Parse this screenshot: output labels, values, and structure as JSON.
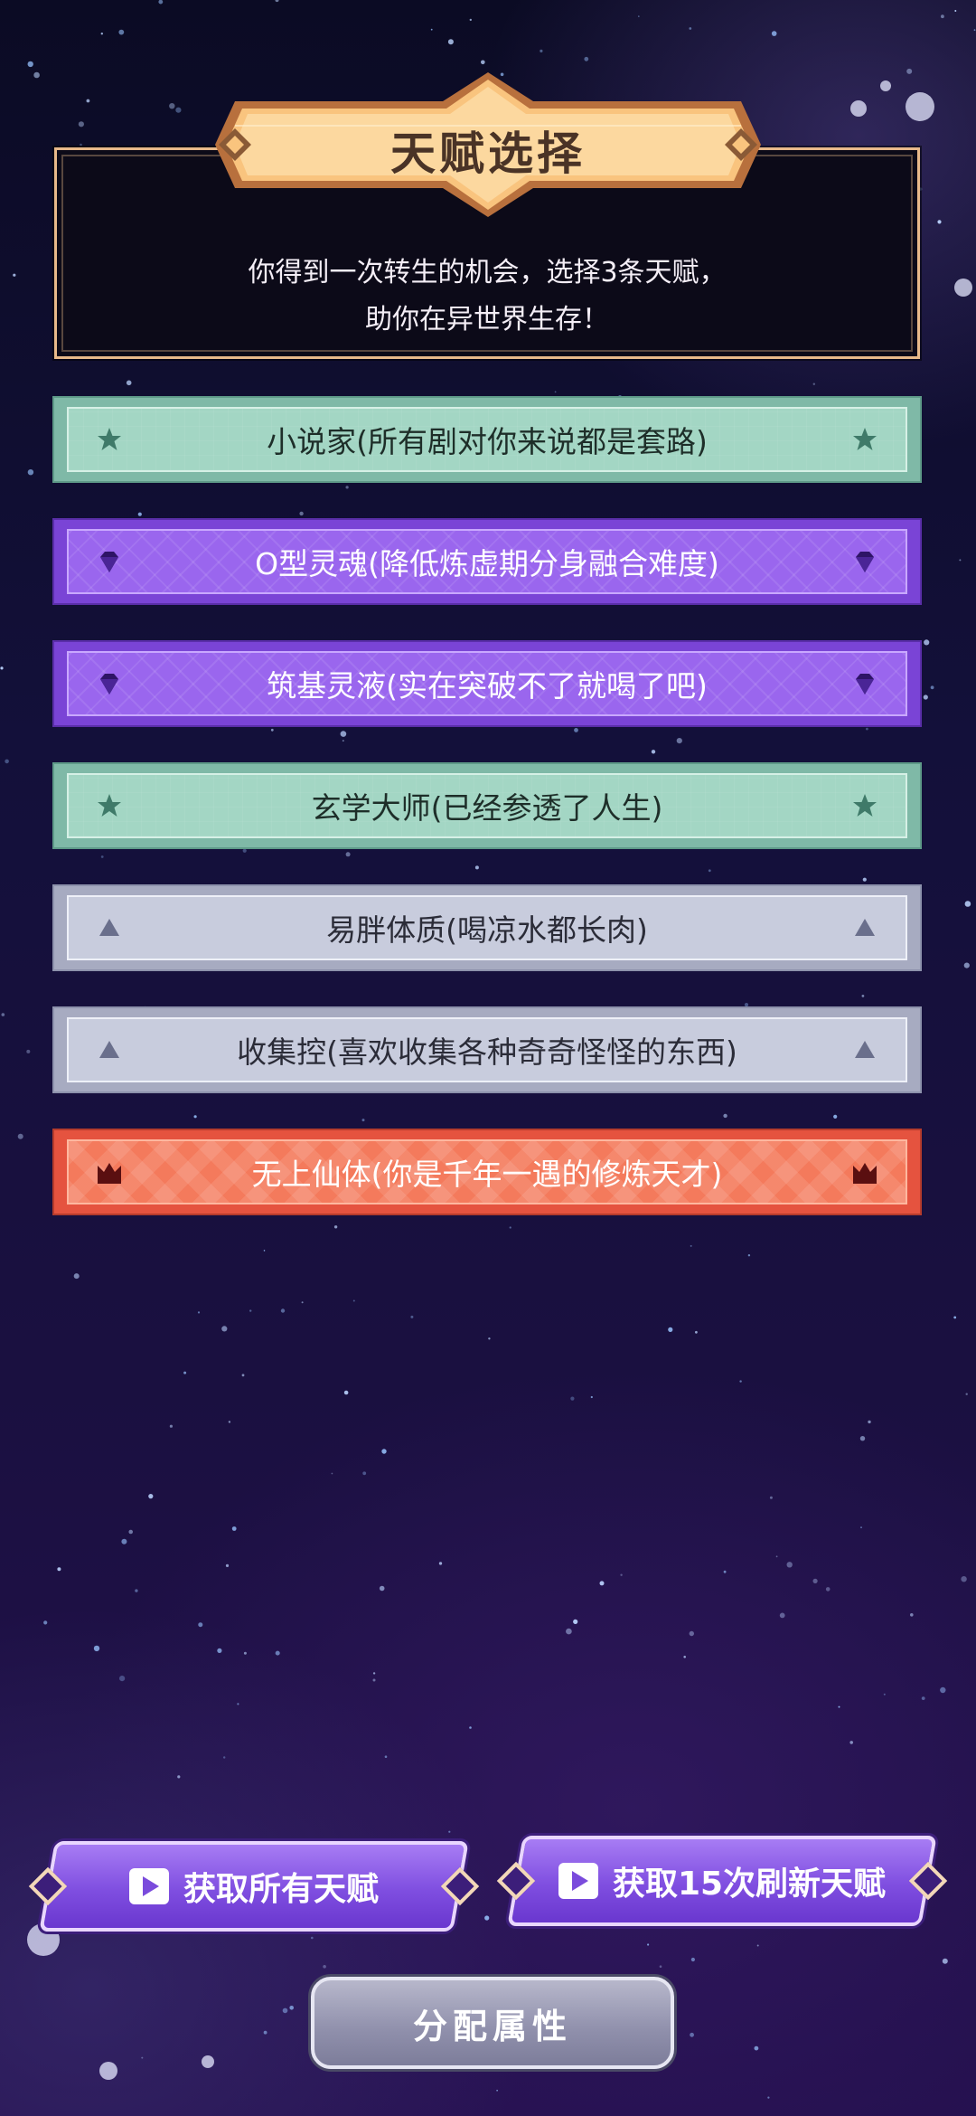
{
  "header": {
    "title": "天赋选择",
    "description_line1": "你得到一次转生的机会，选择3条天赋，",
    "description_line2": "助你在异世界生存！"
  },
  "talents": [
    {
      "label": "小说家(所有剧对你来说都是套路)",
      "tier": "green",
      "icon": "star-icon"
    },
    {
      "label": "O型灵魂(降低炼虚期分身融合难度)",
      "tier": "purple",
      "icon": "gem-icon"
    },
    {
      "label": "筑基灵液(实在突破不了就喝了吧)",
      "tier": "purple",
      "icon": "gem-icon"
    },
    {
      "label": "玄学大师(已经参透了人生)",
      "tier": "green",
      "icon": "star-icon"
    },
    {
      "label": "易胖体质(喝凉水都长肉)",
      "tier": "gray",
      "icon": "triangle-icon"
    },
    {
      "label": "收集控(喜欢收集各种奇奇怪怪的东西)",
      "tier": "gray",
      "icon": "triangle-icon"
    },
    {
      "label": "无上仙体(你是千年一遇的修炼天才)",
      "tier": "red",
      "icon": "crown-icon"
    }
  ],
  "buttons": {
    "get_all": "获取所有天赋",
    "refresh": "获取15次刷新天赋",
    "assign": "分配属性"
  },
  "colors": {
    "green": "#a3d6c4",
    "purple": "#9a66ee",
    "gray": "#c8ccdd",
    "red": "#f47a5c",
    "gold": "#f9c47e"
  }
}
